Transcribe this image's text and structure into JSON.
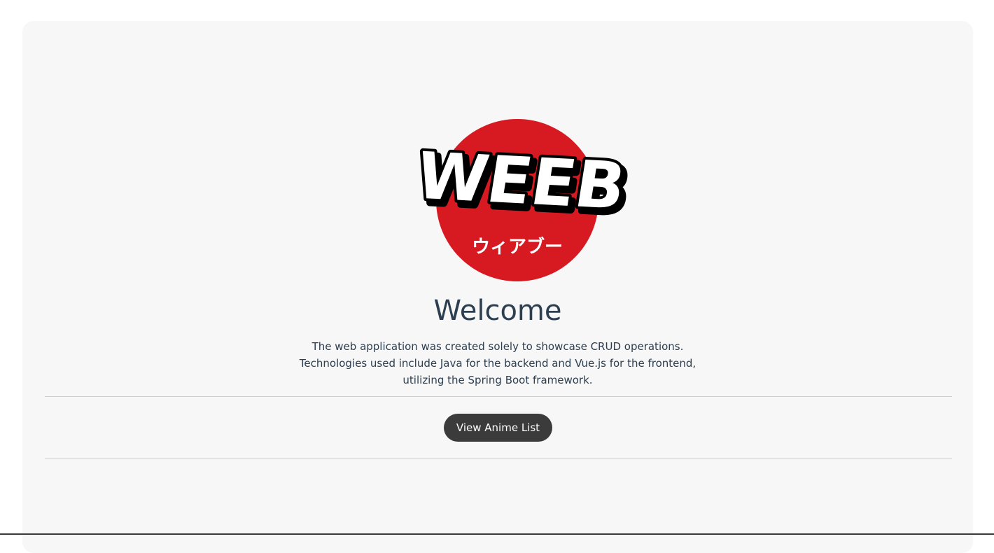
{
  "logo": {
    "text": "WEEB",
    "subtitle": "ウィアブー",
    "circle_color": "#d71921"
  },
  "welcome": {
    "title": "Welcome",
    "description_lines": [
      "The web application was created solely to showcase CRUD operations.",
      "Technologies used include Java for the backend and Vue.js for the frontend,",
      "utilizing the Spring Boot framework."
    ]
  },
  "actions": {
    "view_list_label": "View Anime List"
  },
  "colors": {
    "heading": "#2c3e50",
    "button_bg": "#3b3b3b",
    "card_bg": "#f7f7f7"
  }
}
